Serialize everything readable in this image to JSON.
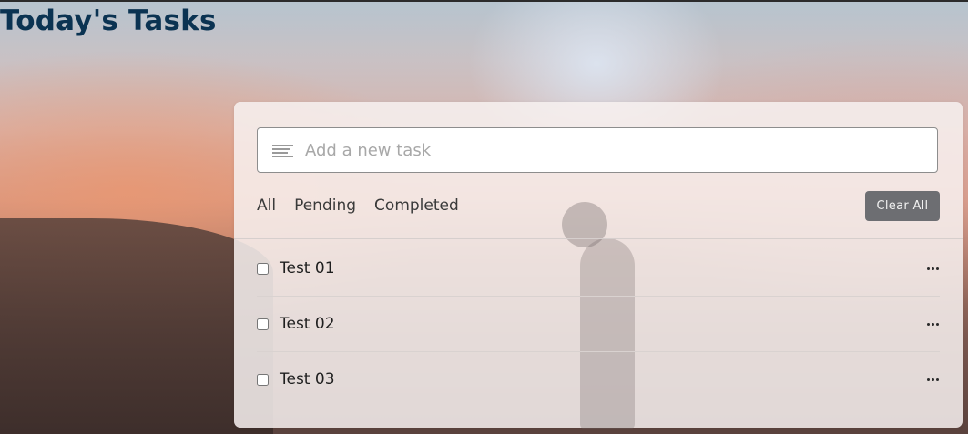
{
  "page": {
    "title": "Today's Tasks"
  },
  "input": {
    "placeholder": "Add a new task",
    "icon": "text-lines-icon"
  },
  "filters": {
    "all": "All",
    "pending": "Pending",
    "completed": "Completed"
  },
  "actions": {
    "clear_all": "Clear All"
  },
  "tasks": [
    {
      "name": "Test 01",
      "completed": false
    },
    {
      "name": "Test 02",
      "completed": false
    },
    {
      "name": "Test 03",
      "completed": false
    }
  ],
  "colors": {
    "title": "#0b3352",
    "clear_button": "#6d6e72"
  }
}
